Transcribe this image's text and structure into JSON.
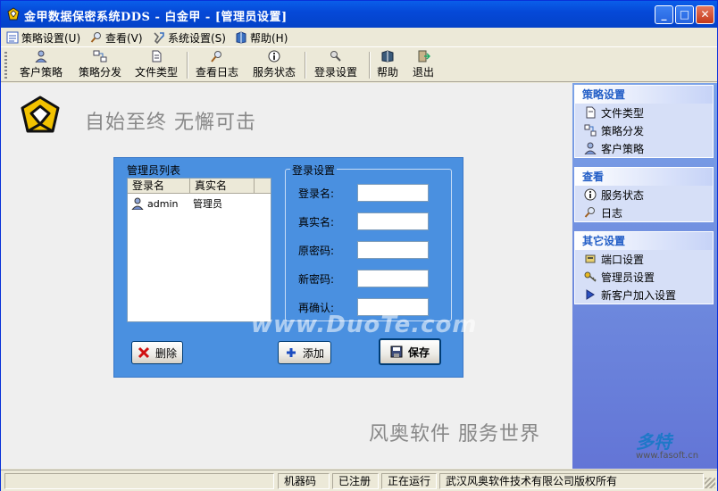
{
  "window": {
    "title": "金甲数据保密系统DDS - 白金甲 - [管理员设置]",
    "controls": {
      "minimize": "_",
      "maximize": "□",
      "close": "✕"
    }
  },
  "menubar": {
    "items": [
      {
        "label": "策略设置(U)",
        "icon": "policy-icon"
      },
      {
        "label": "查看(V)",
        "icon": "search-icon"
      },
      {
        "label": "系统设置(S)",
        "icon": "tools-icon"
      },
      {
        "label": "帮助(H)",
        "icon": "help-book-icon"
      }
    ]
  },
  "toolbar": {
    "items": [
      {
        "label": "客户策略",
        "icon": "user-policy-icon"
      },
      {
        "label": "策略分发",
        "icon": "distribute-icon"
      },
      {
        "label": "文件类型",
        "icon": "file-type-icon"
      },
      {
        "label": "查看日志",
        "icon": "log-icon"
      },
      {
        "label": "服务状态",
        "icon": "info-icon"
      },
      {
        "label": "登录设置",
        "icon": "login-icon"
      },
      {
        "label": "帮助",
        "icon": "help-book-icon"
      },
      {
        "label": "退出",
        "icon": "exit-icon"
      }
    ]
  },
  "main": {
    "slogan": "自始至终 无懈可击",
    "slogan2": "风奥软件 服务世界",
    "admin_list": {
      "label": "管理员列表",
      "columns": [
        "登录名",
        "真实名"
      ],
      "rows": [
        {
          "login": "admin",
          "real_name": "管理员"
        }
      ]
    },
    "login_settings": {
      "label": "登录设置",
      "fields": [
        {
          "label": "登录名:",
          "value": ""
        },
        {
          "label": "真实名:",
          "value": ""
        },
        {
          "label": "原密码:",
          "value": ""
        },
        {
          "label": "新密码:",
          "value": ""
        },
        {
          "label": "再确认:",
          "value": ""
        }
      ]
    },
    "buttons": {
      "delete": "删除",
      "add": "添加",
      "save": "保存"
    },
    "watermark": "www.DuoTe.com"
  },
  "sidebar": {
    "groups": [
      {
        "title": "策略设置",
        "items": [
          {
            "label": "文件类型",
            "icon": "file-type-icon"
          },
          {
            "label": "策略分发",
            "icon": "distribute-icon"
          },
          {
            "label": "客户策略",
            "icon": "user-policy-icon"
          }
        ]
      },
      {
        "title": "查看",
        "items": [
          {
            "label": "服务状态",
            "icon": "info-icon"
          },
          {
            "label": "日志",
            "icon": "log-icon"
          }
        ]
      },
      {
        "title": "其它设置",
        "items": [
          {
            "label": "端口设置",
            "icon": "port-icon"
          },
          {
            "label": "管理员设置",
            "icon": "key-icon"
          },
          {
            "label": "新客户加入设置",
            "icon": "arrow-icon"
          }
        ]
      }
    ]
  },
  "statusbar": {
    "cells": [
      "",
      "机器码",
      "已注册",
      "正在运行",
      "武汉风奥软件技术有限公司版权所有"
    ]
  },
  "corner_watermark": {
    "title": "多特",
    "sub": "www.fasoft.cn"
  },
  "colors": {
    "title_bar": "#0549D8",
    "panel_blue": "#4A90E0",
    "sidebar_header": "#215DC6"
  }
}
